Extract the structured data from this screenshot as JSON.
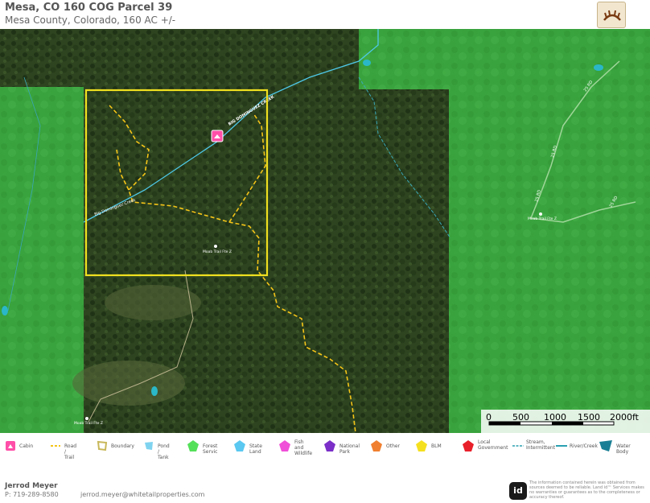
{
  "header": {
    "title": "Mesa, CO 160 COG Parcel 39",
    "subtitle": "Mesa County, Colorado, 160 AC +/-"
  },
  "map": {
    "labels": {
      "creek_name": "BIG DOMINGUEZ CREEK",
      "creek_name_lower": "Big Dominguez Creek",
      "road_25": "25 RD",
      "moab_trail": "Moab Trail Fte Z",
      "moab_trail_east": "Moab Trail Fte Z",
      "moab_trail_sw": "Moab Trail Fte Z"
    },
    "scale": {
      "ticks": [
        "0",
        "500",
        "1000",
        "1500",
        "2000ft"
      ]
    },
    "colors": {
      "state_land": "#3cb043",
      "boundary": "#f0e020",
      "trail": "#f5c518",
      "creek": "#4ec8e8",
      "pond": "#2ab7c7",
      "cabin": "#ff4fa8"
    }
  },
  "legend": [
    {
      "icon": "cabin-icon",
      "label": "Cabin",
      "color": "#ff4fa8"
    },
    {
      "icon": "road-trail-icon",
      "label": "Road / Trail",
      "color": "#f5c518"
    },
    {
      "icon": "boundary-icon",
      "label": "Boundary",
      "color": "#c8b85a"
    },
    {
      "icon": "pond-tank-icon",
      "label": "Pond / Tank",
      "color": "#7fd3ef"
    },
    {
      "icon": "forest-service-icon",
      "label": "Forest Servic",
      "color": "#55e05a"
    },
    {
      "icon": "state-land-icon",
      "label": "State Land",
      "color": "#5ac8f0"
    },
    {
      "icon": "fish-wildlife-icon",
      "label": "Fish and\nWildlife",
      "color": "#f04fd8"
    },
    {
      "icon": "national-park-icon",
      "label": "National Park",
      "color": "#7b2fc8"
    },
    {
      "icon": "other-icon",
      "label": "Other",
      "color": "#f07f2f"
    },
    {
      "icon": "blm-icon",
      "label": "BLM",
      "color": "#f5e020"
    },
    {
      "icon": "local-government-icon",
      "label": "Local\nGovernment",
      "color": "#e8202a"
    },
    {
      "icon": "stream-intermittent-icon",
      "label": "Stream,\nIntermittent",
      "color": "#2aa0b0"
    },
    {
      "icon": "river-creek-icon",
      "label": "River/Creek",
      "color": "#2aa0b0"
    },
    {
      "icon": "water-body-icon",
      "label": "Water Body",
      "color": "#1a7f94"
    }
  ],
  "footer": {
    "agent_name": "Jerrod Meyer",
    "phone": "P: 719-289-8580",
    "email": "jerrod.meyer@whitetailproperties.com",
    "badge": "id",
    "disclaimer": "The information contained herein was obtained from sources deemed to be reliable. Land id™ Services makes no warranties or guarantees as to the completeness or accuracy thereof."
  }
}
